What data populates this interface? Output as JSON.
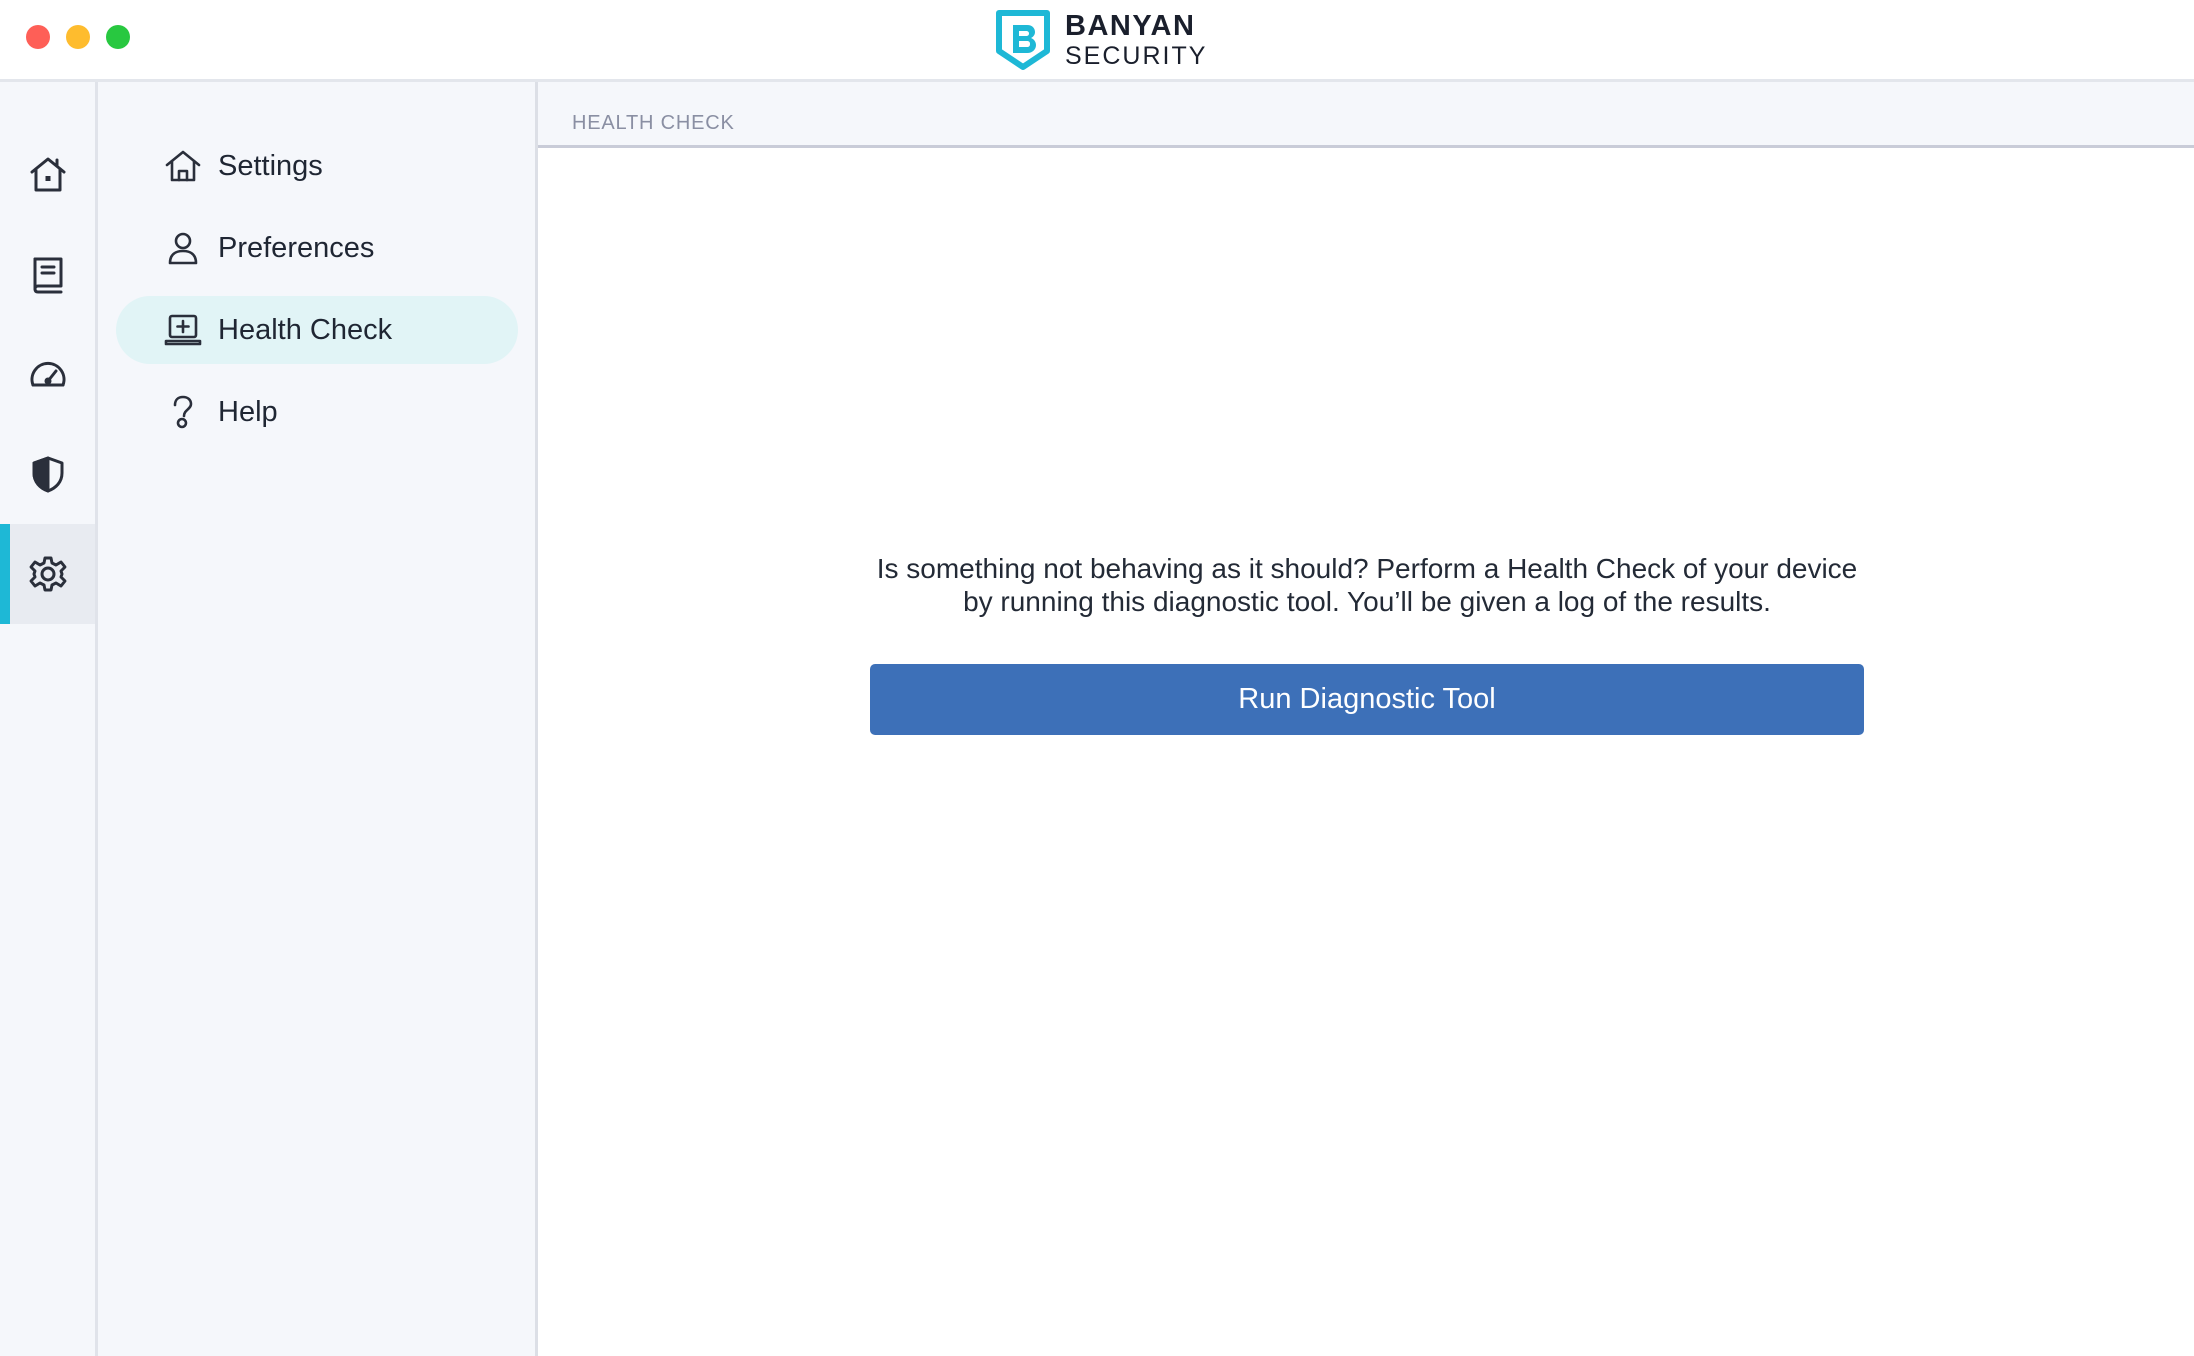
{
  "app": {
    "brand_line1": "BANYAN",
    "brand_line2": "SECURITY",
    "accent_color": "#1eb8d6",
    "button_color": "#3d70b8"
  },
  "rail": {
    "items": [
      {
        "icon": "home-icon"
      },
      {
        "icon": "book-icon"
      },
      {
        "icon": "speedometer-icon"
      },
      {
        "icon": "shield-icon"
      },
      {
        "icon": "gear-icon",
        "active": true
      }
    ]
  },
  "sidebar": {
    "items": [
      {
        "label": "Settings",
        "icon": "house-icon"
      },
      {
        "label": "Preferences",
        "icon": "user-icon"
      },
      {
        "label": "Health Check",
        "icon": "laptop-plus-icon",
        "active": true
      },
      {
        "label": "Help",
        "icon": "question-icon"
      }
    ]
  },
  "main": {
    "breadcrumb": "HEALTH CHECK",
    "description": "Is something not behaving as it should? Perform a Health Check of your device by running this diagnostic tool. You’ll be given a log of the results.",
    "run_button": "Run Diagnostic Tool"
  }
}
